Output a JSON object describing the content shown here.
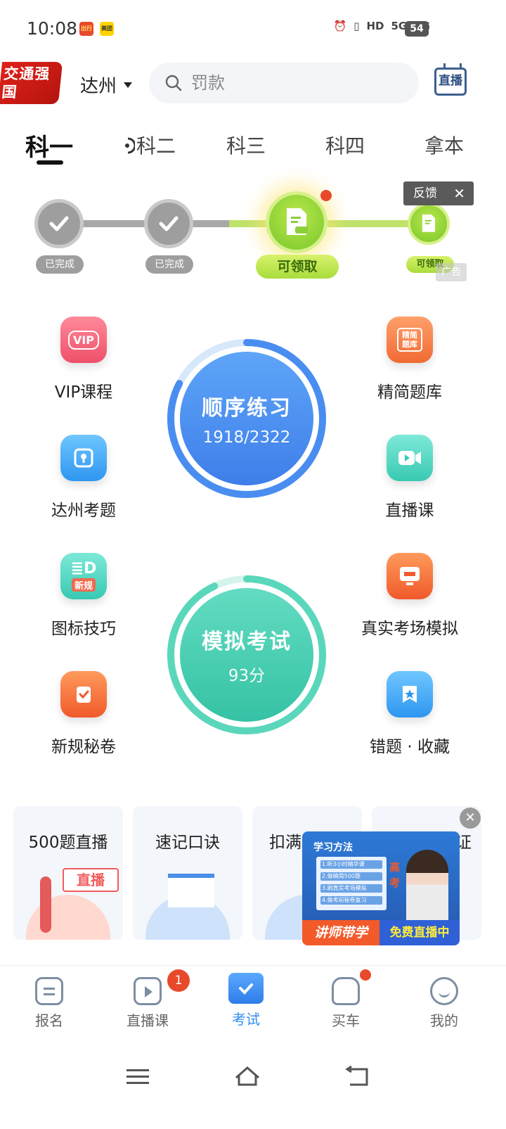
{
  "status": {
    "time": "10:08",
    "app1": "出行",
    "app2": "美团",
    "network": [
      "HD",
      "5G",
      "4G"
    ],
    "battery": "54"
  },
  "header": {
    "brand": "交通强国",
    "city": "达州",
    "search_placeholder": "罚款",
    "live_label": "直播"
  },
  "tabs": [
    "科一",
    "科二",
    "科三",
    "科四",
    "拿本"
  ],
  "progress": {
    "done_label": "已完成",
    "claim_label": "可领取",
    "feedback_label": "反馈",
    "ad_label": "广告"
  },
  "features": {
    "vip": {
      "label": "VIP课程",
      "badge": "VIP"
    },
    "jingjian": {
      "label": "精简题库",
      "badge": "精简题库"
    },
    "dazhou": {
      "label": "达州考题"
    },
    "live_course": {
      "label": "直播课"
    },
    "icon_tips": {
      "label": "图标技巧",
      "badge": "新规"
    },
    "real_sim": {
      "label": "真实考场模拟"
    },
    "new_rules": {
      "label": "新规秘卷"
    },
    "wrong_fav": {
      "label": "错题 · 收藏"
    }
  },
  "practice": {
    "title": "顺序练习",
    "progress_text": "1918/2322",
    "done": 1918,
    "total": 2322
  },
  "exam": {
    "title": "模拟考试",
    "score_text": "93分",
    "score": 93
  },
  "cards": [
    {
      "title": "500题直播",
      "tag": "直播"
    },
    {
      "title": "速记口诀"
    },
    {
      "title": "扣满"
    },
    {
      "title": "证"
    }
  ],
  "video": {
    "title": "学习方法",
    "lines": [
      "1.听3小时精华课",
      "2.做精简500题",
      "3.刷真实考场模拟",
      "4.做考前秘卷复习"
    ],
    "side_text": "高考",
    "left_label": "讲师带学",
    "right_label": "免费直播中"
  },
  "bottom_nav": [
    {
      "label": "报名"
    },
    {
      "label": "直播课",
      "badge": "1"
    },
    {
      "label": "考试"
    },
    {
      "label": "买车"
    },
    {
      "label": "我的"
    }
  ],
  "colors": {
    "accent": "#2f8ef0",
    "practice": "#3f86f0",
    "exam": "#3cc9a6",
    "claim": "#8fd334"
  }
}
